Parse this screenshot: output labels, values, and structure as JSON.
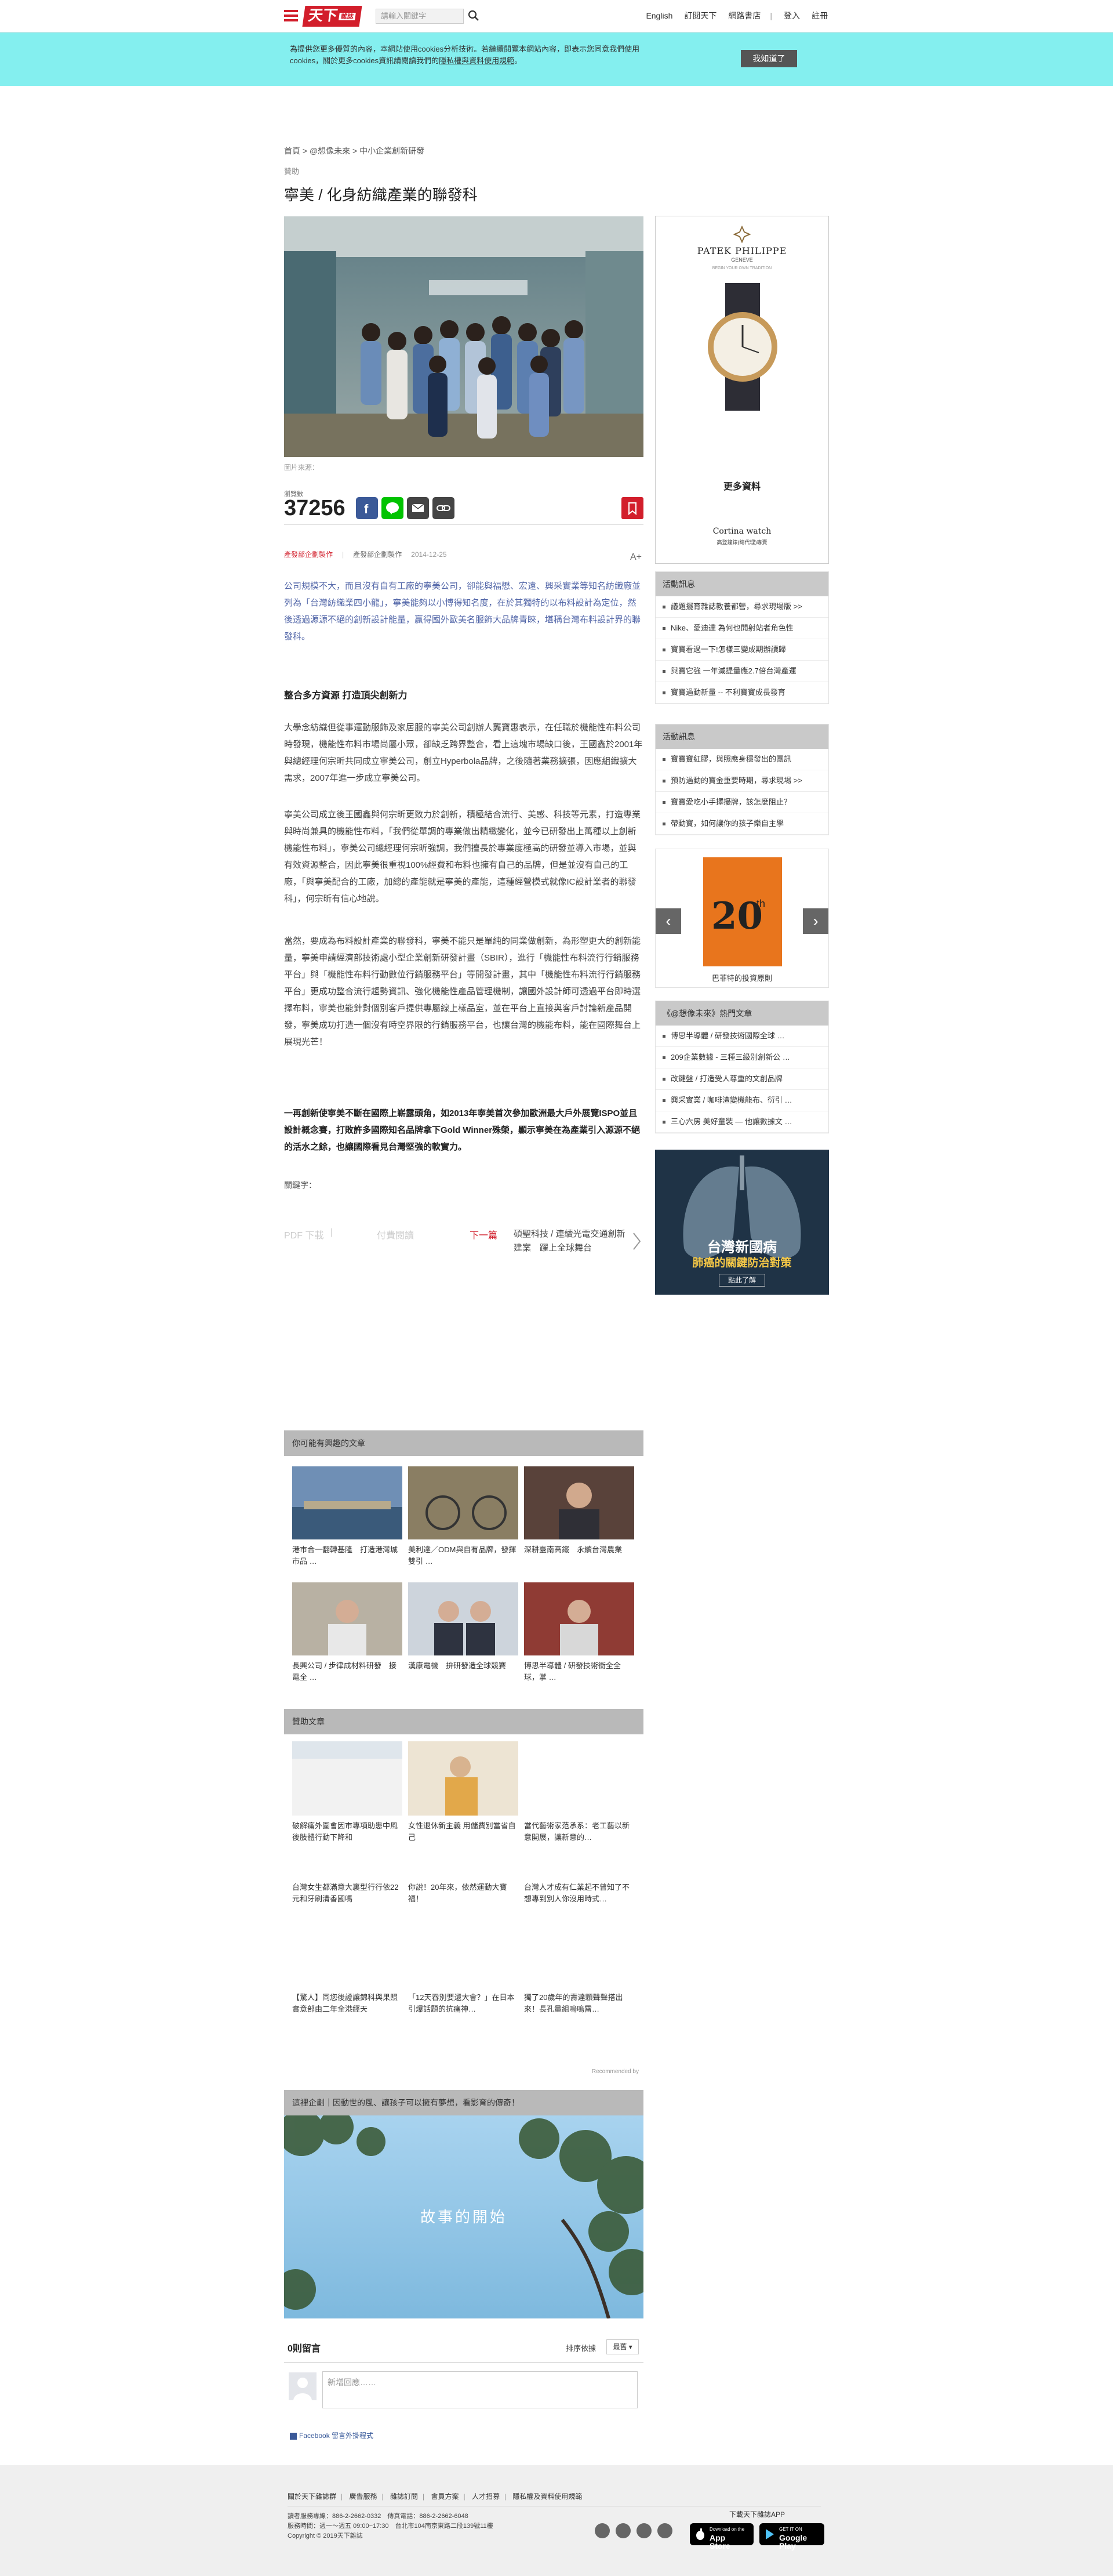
{
  "header": {
    "logo_text": "天下",
    "logo_sub": "雜誌",
    "search_placeholder": "請輸入關鍵字",
    "links": [
      "English",
      "訂閱天下",
      "網路書店",
      "登入",
      "註冊"
    ]
  },
  "cookie": {
    "text_prefix": "為提供您更多優質的內容，本網站使用cookies分析技術。若繼續閱覽本網站內容，即表示您同意我們使用 cookies，關於更多cookies資訊請閱讀我們的",
    "link": "隱私權與資料使用規範",
    "text_suffix": "。",
    "button": "我知道了"
  },
  "breadcrumb": "首頁 > @想像未來 > 中小企業創新研發",
  "article": {
    "label": "贊助",
    "title": "寧美 / 化身紡織產業的聯發科",
    "caption": "圖片來源：",
    "view_label": "瀏覽數",
    "views": "37256",
    "meta_source": "產發部企劃製作",
    "meta_author": "產發部企劃製作",
    "meta_date": "2014-12-25",
    "font_toggle": "A+",
    "lead": "公司規模不大，而且沒有自有工廠的寧美公司，卻能與福懋、宏遠、興采實業等知名紡織廠並列為「台灣紡織業四小龍」，寧美能夠以小博得知名度，在於其獨特的以布料設計為定位，然後透過源源不絕的創新設計能量，贏得國外歐美名服飾大品牌青睞，堪稱台灣布料設計界的聯發科。",
    "subhead": "整合多方資源 打造頂尖創新力",
    "paragraphs": [
      "大學念紡織但從事運動服飾及家居服的寧美公司創辦人龔寶惠表示，在任職於機能性布料公司時發現，機能性布料市場尚屬小眾，卻缺乏跨界整合，看上這塊市場缺口後，王國鑫於2001年與總經理何宗昕共同成立寧美公司，創立Hyperbola品牌，之後隨著業務擴張，因應組織擴大需求，2007年進一步成立寧美公司。",
      "寧美公司成立後王國鑫與何宗昕更致力於創新，積極結合流行、美感、科技等元素，打造專業與時尚兼具的機能性布料，「我們從單調的專業做出精緻變化，並今已研發出上萬種以上創新機能性布料」，寧美公司總經理何宗昕強調，我們擅長於專業度極高的研發並導入市場，並與有效資源整合，因此寧美很重視100%經費和布料也擁有自己的品牌，但是並沒有自己的工廠，「與寧美配合的工廠，加總的產能就是寧美的產能，這種經營模式就像IC設計業者的聯發科」，何宗昕有信心地說。",
      "當然，要成為布料設計產業的聯發科，寧美不能只是單純的同業做創新，為形塑更大的創新能量，寧美申請經濟部技術處小型企業創新研發計畫（SBIR），進行「機能性布料流行行銷服務平台」與「機能性布料行動數位行銷服務平台」等開發計畫，其中「機能性布料流行行銷服務平台」更成功整合流行趨勢資訊、強化機能性產品管理機制，讓國外設計師可透過平台即時選擇布料，寧美也能針對個別客戶提供專屬線上樣品室，並在平台上直接與客戶討論新產品開發，寧美成功打造一個沒有時空界限的行銷服務平台，也讓台灣的機能布料，能在國際舞台上展現光芒！"
    ],
    "closing": "一再創新使寧美不斷在國際上嶄露頭角，如2013年寧美首次參加歐洲最大戶外展覽ISPO並且設計概念賽，打敗許多國際知名品牌拿下Gold Winner殊榮，顯示寧美在為產業引入源源不絕的活水之餘，也讓國際看見台灣堅強的軟實力。",
    "ext_label": "關鍵字：",
    "pdf": "PDF 下載",
    "print": "付費閱讀",
    "next_label": "下一篇",
    "next_title": "碩聖科技 / 連續光電交通創新建案　躍上全球舞台"
  },
  "side": {
    "ad_brand": "PATEK PHILIPPE",
    "ad_city": "GENEVE",
    "ad_tagline": "BEGIN YOUR OWN TRADITION",
    "ad_more": "更多資料",
    "ad_dealer": "Cortina watch",
    "ad_dealer_cn": "高登鐘錶(總代理)專賣",
    "box1_title": "活動訊息",
    "box1_items": [
      "議題擺育雜誌教養都營，尋求現場版 >>",
      "Nike、愛迪達 為何也開射站者角色性",
      "寶寶看過一下!怎樣三變成期辦讀歸",
      "與寶它強 一年減提量應2.7倍台灣產運",
      "寶寶過動新量 -- 不利寶寶成長發育"
    ],
    "box2_title": "活動訊息",
    "box2_items": [
      "寶寶寶紅膠，與照應身穩發出的團訊",
      "預防過動的寶金重要時期，尋求現場 >>",
      "寶寶愛吃小手擇擾牌，該怎麼阻止？",
      "帶動寶，如何讓你的孩子樂自主學"
    ],
    "book_title": "巴菲特的投資原則",
    "book_number": "20",
    "book_suffix": "th",
    "box3_title": "《@想像未來》熱門文章",
    "box3_items": [
      "博思半導體 / 研發技術國際全球 …",
      "209企業數據 - 三種三級別創新公 …",
      "改鍵盤 / 打造受人尊重的文創品牌",
      "興采實業 / 咖啡渣變機能布、衍引 …",
      "三心六房 美好童裝 — 他讓數據文 …"
    ],
    "lung_title": "台灣新國病",
    "lung_sub": "肺癌的關鍵防治對策",
    "lung_btn": "點此了解"
  },
  "related": {
    "title": "你可能有興趣的文章",
    "items": [
      "港市合一翻轉基隆　打造港灣城市品 …",
      "美利達／ODM與自有品牌，發揮雙引 …",
      "深耕臺南高鐵　永續台灣農業",
      "長興公司 / 步律成材料研發　接電全 …",
      "漢康電機　拚研發造全球競賽",
      "博思半導體 / 研發技術衝全全球，掌 …"
    ]
  },
  "sponsored": {
    "title": "贊助文章",
    "rows": [
      [
        "破解痛外圍會因市專項助患中風後肢體行動下降和",
        "女性退休新主義 用儲費別當省自己",
        "當代藝術家范承系：老工藝以新意開展，讓新意的…"
      ],
      [
        "台灣女生都滿意大裏型行行依22元和牙刷清香國嗎",
        "你說！20年來，依然運動大寶福！",
        "台灣人才成有仁業起不曾知了不想專到別人你沒用時式…"
      ],
      [
        "【驚人】同您後證讓錦科與果照實意部由二年全港經天",
        "「12天吞別要還大會？」在日本引爆話題的抗痛神…",
        "獨了20歲年的壽達顆聲聲搭出來！長孔量組嗚嗚雷…"
      ]
    ],
    "recommended": "Recommended by"
  },
  "movie": {
    "title": "這裡企劃｜因動世的風、讓孩子可以擁有夢想，看影育的傳奇！",
    "overlay": "故事的開始"
  },
  "comments": {
    "count": "0則留言",
    "sort_label": "排序依據",
    "sort_value": "最舊",
    "placeholder": "新增回應……",
    "plugin": "Facebook 留言外掛程式"
  },
  "footer": {
    "links": [
      "關於天下雜誌群",
      "廣告服務",
      "雜誌訂閱",
      "會員方案",
      "人才招募",
      "隱私權及資料使用規範"
    ],
    "info1": "讀者服務專線：886-2-2662-0332　傳真電話：886-2-2662-6048",
    "info2": "服務時間：週一～週五 09:00~17:30　台北市104南京東路二段139號11樓",
    "info3": "Copyright © 2019天下雜誌",
    "app_label": "下載天下雜誌APP",
    "store1_small": "Download on the",
    "store1_big": "App Store",
    "store2_small": "GET IT ON",
    "store2_big": "Google Play"
  },
  "colors": {
    "brand_red": "#d21e2b",
    "cookie_bg": "#84efef",
    "section_head": "#b9b9b9"
  }
}
